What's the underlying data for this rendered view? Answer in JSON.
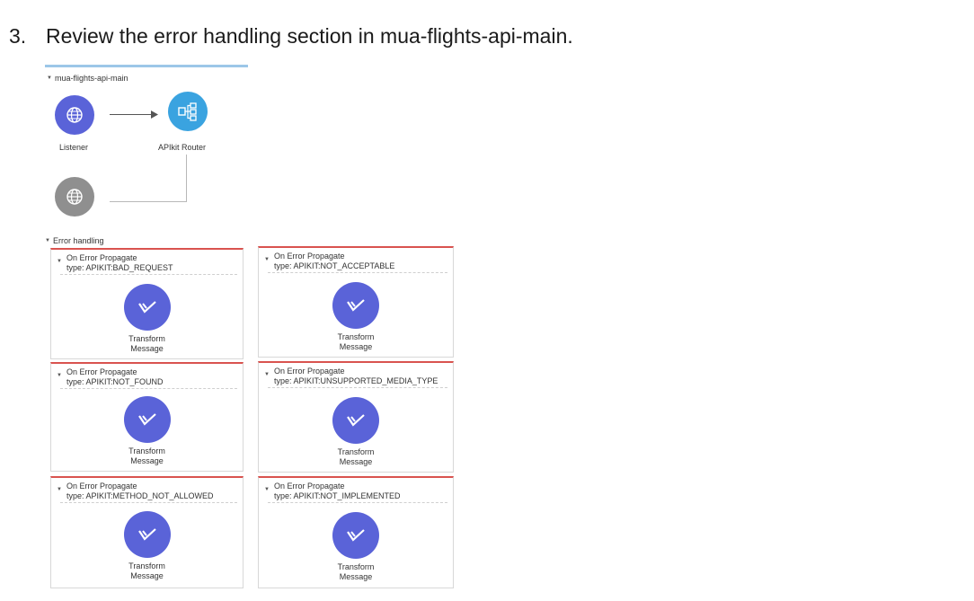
{
  "instruction": {
    "number": "3.",
    "text": "Review the error handling section in mua-flights-api-main."
  },
  "flow": {
    "name": "mua-flights-api-main",
    "listener_label": "Listener",
    "router_label": "APIkit Router",
    "error_handling_label": "Error handling"
  },
  "colors": {
    "listener": "#5a63d8",
    "router": "#3aa3e0",
    "transform": "#5a63d8",
    "error_accent": "#d9534f",
    "disabled": "#8f8f8f"
  },
  "error_handlers": [
    {
      "title": "On Error Propagate",
      "type": "type: APIKIT:BAD_REQUEST",
      "component": [
        "Transform",
        "Message"
      ]
    },
    {
      "title": "On Error Propagate",
      "type": "type: APIKIT:NOT_ACCEPTABLE",
      "component": [
        "Transform",
        "Message"
      ]
    },
    {
      "title": "On Error Propagate",
      "type": "type: APIKIT:NOT_FOUND",
      "component": [
        "Transform",
        "Message"
      ]
    },
    {
      "title": "On Error Propagate",
      "type": "type: APIKIT:UNSUPPORTED_MEDIA_TYPE",
      "component": [
        "Transform",
        "Message"
      ]
    },
    {
      "title": "On Error Propagate",
      "type": "type: APIKIT:METHOD_NOT_ALLOWED",
      "component": [
        "Transform",
        "Message"
      ]
    },
    {
      "title": "On Error Propagate",
      "type": "type: APIKIT:NOT_IMPLEMENTED",
      "component": [
        "Transform",
        "Message"
      ]
    }
  ]
}
